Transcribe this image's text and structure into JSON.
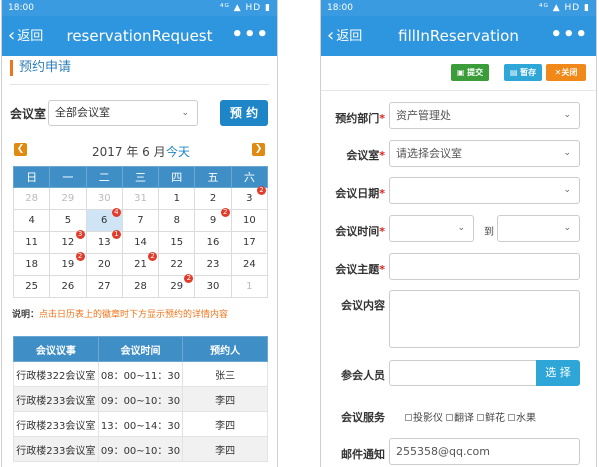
{
  "left": {
    "statusbar": {
      "time": "18:00",
      "indicators": "⁴ᴳ ▲ HD ▮"
    },
    "navbar": {
      "back": "返回",
      "title": "reservationRequest",
      "more": "•••"
    },
    "section_title": "预约申请",
    "room_label": "会议室",
    "room_select": "全部会议室",
    "reserve_button": "预 约",
    "month_label": "2017 年 6 月",
    "today_link": "今天",
    "weekdays": [
      "日",
      "一",
      "二",
      "三",
      "四",
      "五",
      "六"
    ],
    "calendar": [
      [
        {
          "d": "28",
          "o": true
        },
        {
          "d": "29",
          "o": true
        },
        {
          "d": "30",
          "o": true
        },
        {
          "d": "31",
          "o": true
        },
        {
          "d": "1"
        },
        {
          "d": "2"
        },
        {
          "d": "3",
          "b": "2"
        }
      ],
      [
        {
          "d": "4"
        },
        {
          "d": "5"
        },
        {
          "d": "6",
          "b": "4",
          "today": true
        },
        {
          "d": "7"
        },
        {
          "d": "8"
        },
        {
          "d": "9",
          "b": "2"
        },
        {
          "d": "10"
        }
      ],
      [
        {
          "d": "11"
        },
        {
          "d": "12",
          "b": "3"
        },
        {
          "d": "13",
          "b": "1"
        },
        {
          "d": "14"
        },
        {
          "d": "15"
        },
        {
          "d": "16"
        },
        {
          "d": "17"
        }
      ],
      [
        {
          "d": "18"
        },
        {
          "d": "19",
          "b": "2"
        },
        {
          "d": "20"
        },
        {
          "d": "21",
          "b": "2"
        },
        {
          "d": "22"
        },
        {
          "d": "23"
        },
        {
          "d": "24"
        }
      ],
      [
        {
          "d": "25"
        },
        {
          "d": "26"
        },
        {
          "d": "27"
        },
        {
          "d": "28"
        },
        {
          "d": "29",
          "b": "2"
        },
        {
          "d": "30"
        },
        {
          "d": "1",
          "o": true
        }
      ]
    ],
    "note_prefix": "说明：",
    "note_text": "点击日历表上的徽章时下方显示预约的详情内容",
    "reservations": {
      "headers": [
        "会议议事",
        "会议时间",
        "预约人"
      ],
      "rows": [
        [
          "行政楼322会议室",
          "08：00~11：30",
          "张三"
        ],
        [
          "行政楼233会议室",
          "09：00~10：30",
          "李四"
        ],
        [
          "行政楼233会议室",
          "13：00~14：30",
          "李四"
        ],
        [
          "行政楼233会议室",
          "09：00~10：30",
          "李四"
        ]
      ]
    }
  },
  "right": {
    "statusbar": {
      "time": "18:00",
      "indicators": "⁴ᴳ ▲ HD ▮"
    },
    "navbar": {
      "back": "返回",
      "title": "fillInReservation",
      "more": "•••"
    },
    "buttons": {
      "submit": "提交",
      "save": "暂存",
      "close": "关闭"
    },
    "form": {
      "dept_label": "预约部门",
      "dept_value": "资产管理处",
      "room_label": "会议室",
      "room_placeholder": "请选择会议室",
      "date_label": "会议日期",
      "time_label": "会议时间",
      "to_label": "到",
      "subject_label": "会议主题",
      "content_label": "会议内容",
      "participants_label": "参会人员",
      "select_button": "选 择",
      "services_label": "会议服务",
      "services": [
        "投影仪",
        "翻译",
        "鲜花",
        "水果"
      ],
      "email_label": "邮件通知",
      "email_value": "255358@qq.com"
    }
  }
}
